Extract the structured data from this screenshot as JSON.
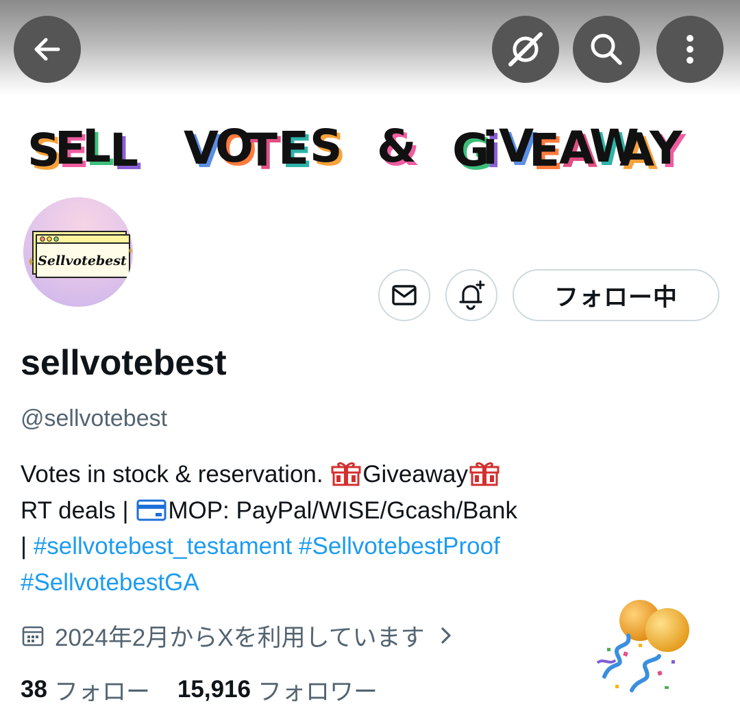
{
  "nav": {
    "back_icon": "arrow-left-icon",
    "grok_icon": "grok-icon",
    "search_icon": "search-icon",
    "more_icon": "more-vertical-icon"
  },
  "banner": {
    "words": [
      {
        "text": "SELL",
        "letters": [
          "S",
          "E",
          "L",
          "L"
        ]
      },
      {
        "text": "VOTES",
        "letters": [
          "V",
          "O",
          "T",
          "E",
          "S"
        ]
      },
      {
        "text": "&",
        "letters": [
          "&"
        ]
      },
      {
        "text": "GiVEAWAY",
        "letters": [
          "G",
          "i",
          "V",
          "E",
          "A",
          "W",
          "A",
          "Y"
        ]
      }
    ],
    "shadow_colors": [
      "#f7a23a",
      "#ef5da0",
      "#3dbf7a",
      "#8a5fd6",
      "#5b8fe6",
      "#ff7a3d",
      "#e04f83",
      "#2fb3a9"
    ]
  },
  "avatar": {
    "logo_text": "Sellvotebest",
    "window_color": "#fff59d",
    "dot_colors": [
      "#ff8a80",
      "#ffd54f",
      "#81c784"
    ]
  },
  "actions": {
    "dm_icon": "envelope-icon",
    "notify_icon": "bell-plus-icon",
    "follow_label": "フォロー中"
  },
  "profile": {
    "display_name": "sellvotebest",
    "handle": "@sellvotebest",
    "bio": {
      "line1_a": "Votes in stock & reservation. ",
      "line1_b": "Giveaway",
      "line2_a": "RT deals | ",
      "line2_b": "MOP: PayPal/WISE/Gcash/Bank",
      "line3_a": "| ",
      "hashtag1": "#sellvotebest_testament",
      "hashtag2": "#SellvotebestProof",
      "hashtag3": "#SellvotebestGA"
    },
    "gift_icon": "gift-icon",
    "card_icon": "credit-card-icon",
    "join_icon": "calendar-icon",
    "join_text": "2024年2月からXを利用しています",
    "join_chevron": "chevron-right-icon",
    "following_count": "38",
    "following_label": "フォロー",
    "followers_count": "15,916",
    "followers_label": "フォロワー",
    "decoration_icon": "balloons-confetti-icon"
  },
  "colors": {
    "accent_link": "#1d9bf0",
    "secondary_text": "#536471",
    "nav_button_bg": "#555555",
    "border": "#cfd9de"
  }
}
